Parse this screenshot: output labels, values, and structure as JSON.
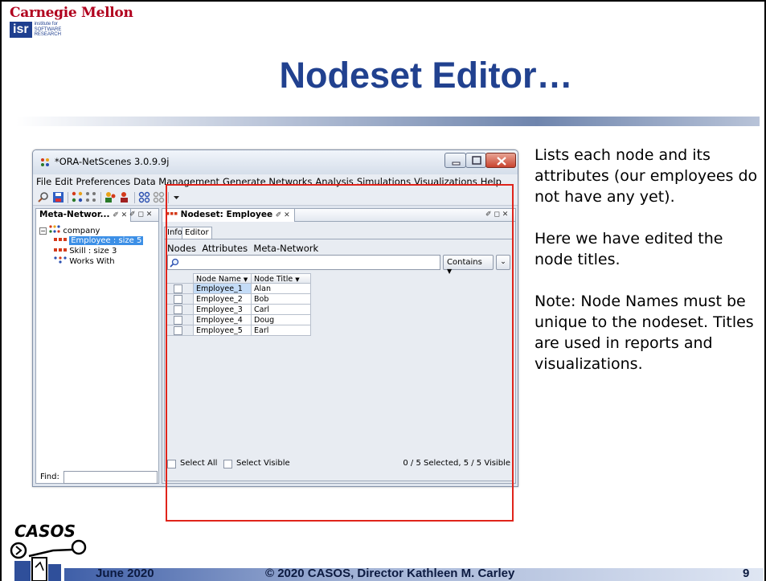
{
  "slide": {
    "org_name": "Carnegie Mellon",
    "isr_mark": "isr",
    "isr_subtitle": "institute for SOFTWARE RESEARCH",
    "title": "Nodeset Editor…",
    "notes": [
      "Lists each node and its attributes (our employees do not have any yet).",
      "Here we have edited the node titles.",
      "Note: Node Names must be unique to the nodeset. Titles are used in reports and visualizations."
    ],
    "footer": {
      "date": "June 2020",
      "copyright": "© 2020 CASOS, Director Kathleen M. Carley",
      "page": "9"
    },
    "casos_logo_text": "CASOS",
    "accent_color": "#21418f",
    "highlight_color": "#e0241b"
  },
  "window": {
    "title": "*ORA-NetScenes 3.0.9.9j",
    "menu": [
      "File",
      "Edit",
      "Preferences",
      "Data Management",
      "Generate Networks",
      "Analysis",
      "Simulations",
      "Visualizations",
      "Help"
    ]
  },
  "left_panel": {
    "tab_label": "Meta-Networ...",
    "tab_pin": "✐ ✕",
    "panel_controls": "✐ ◻ ✕",
    "tree": {
      "root": "company",
      "items": [
        {
          "label": "Employee : size 5",
          "selected": true,
          "icon": "nodeset-icon"
        },
        {
          "label": "Skill : size 3",
          "selected": false,
          "icon": "nodeset-icon"
        },
        {
          "label": "Works With",
          "selected": false,
          "icon": "network-icon"
        }
      ]
    },
    "find_label": "Find:",
    "find_value": ""
  },
  "right_panel": {
    "tab_label": "Nodeset: Employee",
    "tab_pin": "✐ ✕",
    "panel_controls": "✐ ◻ ✕",
    "subtabs": [
      "Info",
      "Editor"
    ],
    "editor_tabs": "Nodes  Attributes  Meta-Network",
    "search_value": "",
    "contains_label": "Contains",
    "columns": [
      "Node Name",
      "Node Title"
    ],
    "rows": [
      {
        "name": "Employee_1",
        "title": "Alan"
      },
      {
        "name": "Employee_2",
        "title": "Bob"
      },
      {
        "name": "Employee_3",
        "title": "Carl"
      },
      {
        "name": "Employee_4",
        "title": "Doug"
      },
      {
        "name": "Employee_5",
        "title": "Earl"
      }
    ],
    "select_all": "Select All",
    "select_visible": "Select Visible",
    "status": "0 / 5 Selected, 5 / 5 Visible"
  }
}
